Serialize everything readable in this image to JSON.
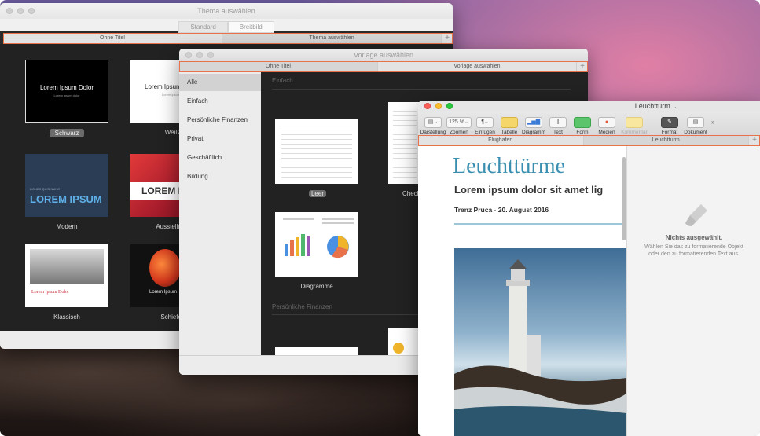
{
  "theme_window": {
    "title": "Thema auswählen",
    "segments": [
      "Standard",
      "Breitbild"
    ],
    "tabs": [
      "Ohne Titel",
      "Thema auswählen"
    ],
    "themes": [
      {
        "label": "Schwarz",
        "preview_title": "Lorem Ipsum Dolor",
        "preview_sub": "Lorem ipsum dolor"
      },
      {
        "label": "Weiß",
        "preview_title": "Lorem Ipsum Dolor",
        "preview_sub": "Lorem ipsum dolor"
      },
      {
        "label": "Modern",
        "preview_kicker": "DONEC QUIS NUNC",
        "preview_title": "LOREM IPSUM"
      },
      {
        "label": "Ausstellung",
        "preview_title": "LOREM IPSUM"
      },
      {
        "label": "Klassisch",
        "preview_title": "Lorem Ipsum Dolor"
      },
      {
        "label": "Schiefer",
        "preview_title": "Lorem Ipsum"
      }
    ]
  },
  "template_window": {
    "title": "Vorlage auswählen",
    "tabs": [
      "Ohne Titel",
      "Vorlage auswählen"
    ],
    "categories": [
      "Alle",
      "Einfach",
      "Persönliche Finanzen",
      "Privat",
      "Geschäftlich",
      "Bildung"
    ],
    "sections": [
      "Einfach",
      "Persönliche Finanzen"
    ],
    "templates": [
      {
        "label": "Leer"
      },
      {
        "label": "Checkliste"
      },
      {
        "label": "Diagramme"
      }
    ]
  },
  "pages_window": {
    "title": "Leuchtturm",
    "toolbar": [
      {
        "label": "Darstellung",
        "icon": "view-icon"
      },
      {
        "label": "Zoomen",
        "icon": "zoom-icon",
        "value": "125 %"
      },
      {
        "label": "Einfügen",
        "icon": "paragraph-icon"
      },
      {
        "label": "Tabelle",
        "icon": "table-icon"
      },
      {
        "label": "Diagramm",
        "icon": "chart-icon"
      },
      {
        "label": "Text",
        "icon": "text-icon"
      },
      {
        "label": "Form",
        "icon": "shape-icon"
      },
      {
        "label": "Medien",
        "icon": "media-icon"
      },
      {
        "label": "Kommentar",
        "icon": "comment-icon"
      },
      {
        "label": "Format",
        "icon": "format-brush-icon"
      },
      {
        "label": "Dokument",
        "icon": "document-icon"
      }
    ],
    "tabs": [
      "Flughafen",
      "Leuchtturm"
    ],
    "document": {
      "title": "Leuchttürme",
      "subtitle": "Lorem ipsum dolor sit amet lig",
      "author": "Trenz Pruca - 20. August 2016"
    },
    "inspector": {
      "title": "Nichts ausgewählt.",
      "text": "Wählen Sie das zu formatierende Objekt oder den zu formatierenden Text aus."
    }
  },
  "colors": {
    "highlight": "#e8734a",
    "doc_title": "#3a8fb0"
  }
}
